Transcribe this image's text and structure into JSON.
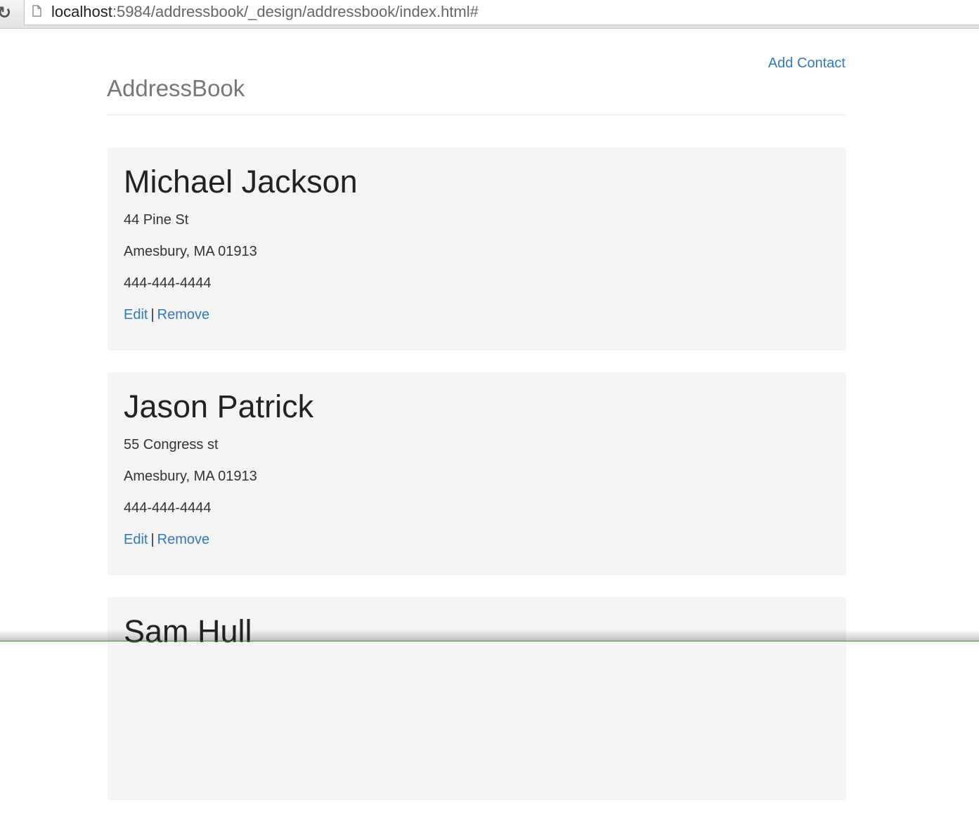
{
  "browser": {
    "url_host": "localhost",
    "url_rest": ":5984/addressbook/_design/addressbook/index.html#"
  },
  "header": {
    "title": "AddressBook",
    "add_contact_label": "Add Contact"
  },
  "contacts": [
    {
      "name": "Michael Jackson",
      "street": "44 Pine St",
      "city_line": "Amesbury, MA 01913",
      "phone": "444-444-4444",
      "edit_label": "Edit",
      "separator": "|",
      "remove_label": "Remove"
    },
    {
      "name": "Jason Patrick",
      "street": "55 Congress st",
      "city_line": "Amesbury, MA 01913",
      "phone": "444-444-4444",
      "edit_label": "Edit",
      "separator": "|",
      "remove_label": "Remove"
    },
    {
      "name": "Sam Hull"
    }
  ],
  "colors": {
    "link": "#337ab7",
    "card_background": "#f4f4f4",
    "title": "#777777"
  },
  "icons": {
    "reload": "reload-icon",
    "page": "page-icon"
  }
}
